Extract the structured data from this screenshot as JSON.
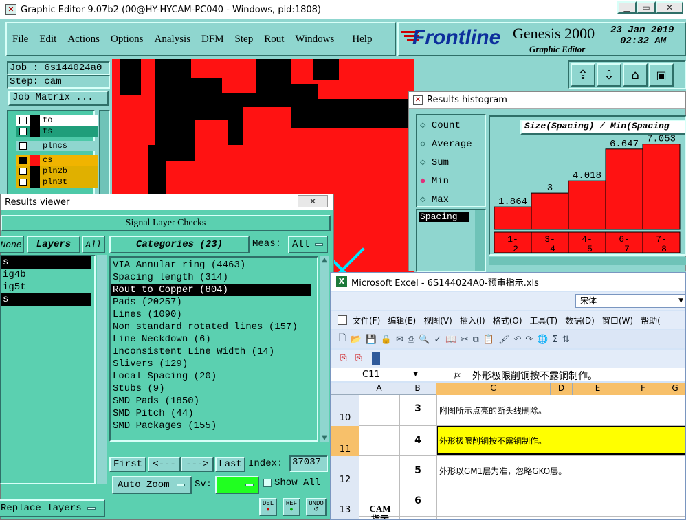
{
  "main_window": {
    "title": "Graphic Editor 9.07b2 (00@HY-HYCAM-PC040 - Windows, pid:1808)",
    "menu": [
      "File",
      "Edit",
      "Actions",
      "Options",
      "Analysis",
      "DFM",
      "Step",
      "Rout",
      "Windows",
      "Help"
    ],
    "brand": "Frontline",
    "product": "Genesis 2000",
    "subtitle": "Graphic Editor",
    "date": "23 Jan 2019",
    "time": "02:32 AM",
    "job_label": "Job : 6s144024a0",
    "step_label": "Step: cam",
    "job_matrix_button": "Job Matrix ...",
    "layers": [
      {
        "name": "to",
        "bg": "#ffffff",
        "swatch": "#000000"
      },
      {
        "name": "ts",
        "bg": "#1f9e7a",
        "swatch": "#000000"
      },
      {
        "name": "plncs",
        "bg": "#8fd6cf",
        "swatch": "#8fd6cf"
      },
      {
        "name": "cs",
        "bg": "#f0b400",
        "swatch": "#ff1212"
      },
      {
        "name": "pln2b",
        "bg": "#e0b000",
        "swatch": "#000000"
      },
      {
        "name": "pln3t",
        "bg": "#e0b000",
        "swatch": "#000000"
      }
    ]
  },
  "histogram": {
    "title": "Results histogram",
    "options": [
      "Count",
      "Average",
      "Sum",
      "Min",
      "Max"
    ],
    "selected_option": "Min",
    "list_item": "Spacing",
    "chart_title": "Size(Spacing) / Min(Spacing",
    "bins": [
      "1-2",
      "3-4",
      "4-5",
      "6-7",
      "7-8"
    ],
    "values": [
      1.864,
      3,
      4.018,
      6.647,
      7.053
    ],
    "value_labels": [
      "1.864",
      "3",
      "4.018",
      "6.647",
      "7.053"
    ]
  },
  "results_viewer": {
    "title": "Results viewer",
    "header": "Signal Layer Checks",
    "none_button": "None",
    "layers_label": "Layers",
    "all_button": "All",
    "layer_list": [
      "s",
      "ig4b",
      "ig5t",
      "s"
    ],
    "categories_label": "Categories (23)",
    "meas_label": "Meas:",
    "meas_value": "All",
    "categories": [
      "VIA Annular ring (4463)",
      "Spacing length (314)",
      "Rout to Copper (804)",
      "Pads (20257)",
      "Lines (1090)",
      "Non standard rotated lines (157)",
      "Line Neckdown (6)",
      "Inconsistent Line Width (14)",
      "Slivers (129)",
      "Local Spacing (20)",
      "Stubs (9)",
      "SMD Pads (1850)",
      "SMD Pitch (44)",
      "SMD Packages (155)"
    ],
    "selected_category": "Rout to Copper (804)",
    "first_button": "First",
    "prev_button": "<---",
    "next_button": "--->",
    "last_button": "Last",
    "index_label": "Index:",
    "index_value": "37037",
    "auto_zoom": "Auto Zoom",
    "sv_label": "Sv:",
    "show_all": "Show All",
    "replace_layers": "Replace layers",
    "del_label": "DEL",
    "ref_label": "REF",
    "undo_label": "UNDO"
  },
  "excel": {
    "title": "Microsoft Excel - 6S144024A0-预审指示.xls",
    "font_name": "宋体",
    "menu": [
      "文件(F)",
      "编辑(E)",
      "视图(V)",
      "插入(I)",
      "格式(O)",
      "工具(T)",
      "数据(D)",
      "窗口(W)",
      "帮助("
    ],
    "cell_ref": "C11",
    "fx": "fx",
    "formula": "外形极限削铜按不露铜制作。",
    "columns": [
      "A",
      "B",
      "C",
      "D",
      "E",
      "F",
      "G"
    ],
    "rows": [
      {
        "num": "10",
        "b": "3",
        "c": "附图所示点亮的断头线删除。"
      },
      {
        "num": "11",
        "b": "4",
        "c": "外形极限削铜按不露铜制作。"
      },
      {
        "num": "12",
        "b": "5",
        "c": "外形以GM1层为准，忽略GKO层。"
      },
      {
        "num": "13",
        "b": "6",
        "c": ""
      }
    ],
    "a_label": "CAM\n指示"
  }
}
